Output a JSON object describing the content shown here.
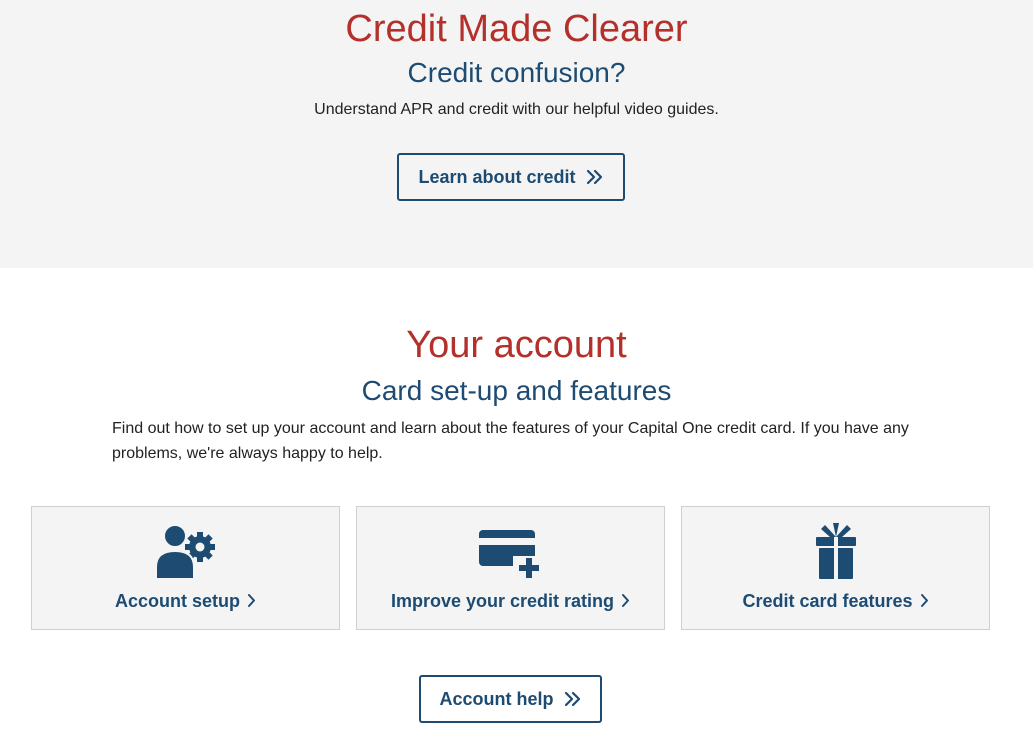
{
  "hero": {
    "title": "Credit Made Clearer",
    "subtitle": "Credit confusion?",
    "body": "Understand APR and credit with our helpful video guides.",
    "button_label": "Learn about credit"
  },
  "account": {
    "title": "Your account",
    "subtitle": "Card set-up and features",
    "body": "Find out how to set up your account and learn about the features of your Capital One credit card. If you have any problems, we're always happy to help.",
    "tiles": [
      {
        "label": "Account setup",
        "icon": "user-gear-icon"
      },
      {
        "label": "Improve your credit rating",
        "icon": "credit-card-plus-icon"
      },
      {
        "label": "Credit card features",
        "icon": "gift-icon"
      }
    ],
    "help_button_label": "Account help"
  },
  "colors": {
    "heading_red": "#b3302b",
    "navy": "#1d4b72",
    "band_grey": "#f4f4f4"
  }
}
